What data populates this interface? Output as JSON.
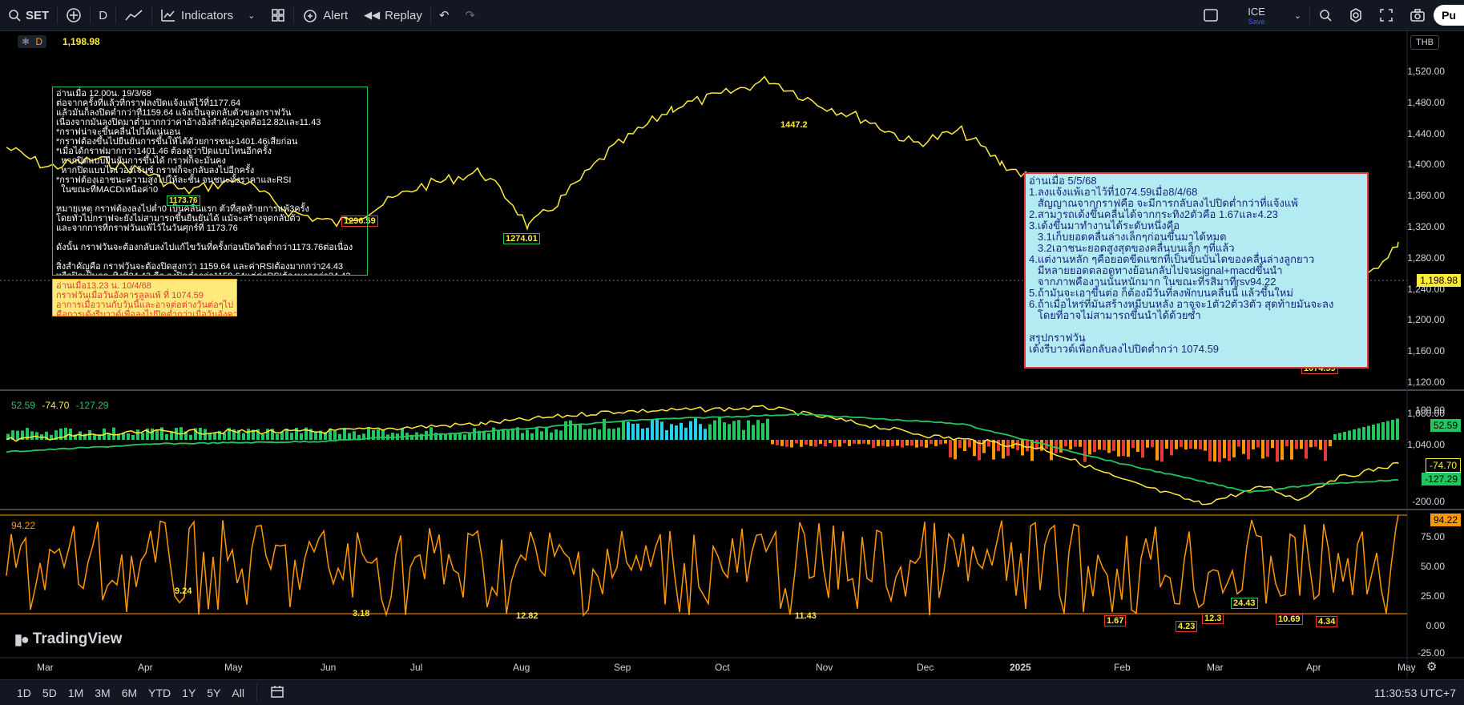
{
  "toolbar": {
    "symbol": "SET",
    "interval": "D",
    "indicators_label": "Indicators",
    "alert_label": "Alert",
    "replay_label": "Replay",
    "layout_name": "ICE",
    "layout_status": "Save",
    "publish_label": "Pu"
  },
  "chart": {
    "interval_badge": "D",
    "last_price": "1,198.98",
    "currency": "THB",
    "price_axis": [
      "1,520.00",
      "1,480.00",
      "1,440.00",
      "1,400.00",
      "1,360.00",
      "1,320.00",
      "1,280.00",
      "1,240.00",
      "1,200.00",
      "1,160.00",
      "1,120.00",
      "1,080.00",
      "1,040.00"
    ],
    "price_tag": "1,198.98",
    "time_axis": [
      "Mar",
      "Apr",
      "May",
      "Jun",
      "Jul",
      "Aug",
      "Sep",
      "Oct",
      "Nov",
      "Dec",
      "2025",
      "Feb",
      "Mar",
      "Apr",
      "May"
    ],
    "peak_labels": {
      "p1447": "1447.2",
      "p1274": "1274.01",
      "p1296": "1296.59",
      "p1173": "1173.76",
      "p1074": "1074.59"
    },
    "brand": "TradingView"
  },
  "macd": {
    "values": [
      "52.59",
      "-74.70",
      "-127.29"
    ],
    "axis": [
      "100.00",
      "-200.00"
    ],
    "tags": [
      "52.59",
      "-74.70",
      "-127.29"
    ]
  },
  "rsi": {
    "top_value": "94.22",
    "axis": [
      "75.00",
      "50.00",
      "25.00",
      "0.00",
      "-25.00"
    ],
    "tag": "94.22",
    "low_labels": [
      "9.24",
      "3.18",
      "12.82",
      "11.43",
      "1.67",
      "4.23",
      "12.3",
      "24.43",
      "10.69",
      "4.34"
    ]
  },
  "notes": {
    "note1": "อ่านเมื่อ 12.00น. 19/3/68\nต่อจากครั้งที่แล้วที่กราฟลงปิดแจ้งแพ้ไว้ที่1177.64\nแล้วมันก็ลงปิดต่ำกว่าที่1159.64 แจ้งเป็นจุดกลับตัวของกราฟวัน\nเนื่องจากมันลงปิดมาต่ำมากกว่าค่าอ้างอิงสำคัญ2จุดคือ12.82และ11.43\n*กราฟน่าจะขึ้นคลื่นไปได้แน่นอน\n*กราฟต้องขึ้นไปยืนยันการขึ้นให้ได้ด้วยการชนะ1401.46เสียก่อน\n*เมื่อได้กราฟมากกว่า1401.46 ต้องดูว่าปิดแบบไหนอีกครั้ง\n  หากปิดแบบยืนยันการขึ้นได้ กราฟก็จะมั่นคง\n  หากปิดแบบไดเวอร์เจ้นซ์ กราฟก็จะกลับลงไปอีกครั้ง\n*กราฟต้องเอาชนะความสูงไปให้ละชั้น จนชนะทั้งราคาและRSI\n  ในขณะที่MACDเหนือค่า0\n\nหมายเหตุ กราฟต้องลงไปต่ำ0 เป็นคลื่นแรก ตัวที่สุดท้ายการแพ้3ครั้ง\nโดยทั่วไปกราฟจะยังไม่สามารถขึ้นยืนยันได้ แม้จะสร้างจุดกลับตัว\nและจากการที่กราฟวันแพ้ไว้ในวันศุกร์ที่ 1173.76\n\nดังนั้น กราฟวันจะต้องกลับลงไปแก้ไขวันที่ครั้งก่อนปิดวิดต่ำกว่า1173.76ต่อเนื่อง\n\nสิ่งสำคัญคือ กราฟวันจะต้องปิดสูงกว่า 1159.64 และค่าRSIต้องมากกว่า24.43\nหรือปิดเป็นกระทิงที่24.43 คือ ลงปิดต่ำกว่า1159.64แต่ค่าRSIต้องมากกว่า24.43",
    "note2": "อ่านเมื่อ13.23 น. 10/4/68\nกราฟวันเมื่อวันอังคารลูลแพ้ ที่ 1074.59\nอาการเมื่อวานกับวันนี้และอาจต่อต่างวันต่อๆไป\nคือการเด้งรีบาวด์เพื่อลงไปปิดต่ำกว่าเมื่อวันอังคาร",
    "note3": "อ่านเมื่อ 5/5/68\n1.ลงแจ้งแพ้เอาไว้ที่1074.59เมื่อ8/4/68\n   สัญญาณจากกราฟคือ จะมีการกลับลงไปปิดต่ำกว่าที่แจ้งแพ้\n2.สามารถเด้งขึ้นคลื่นได้จากกระทิง2ตัวคือ 1.67และ4.23\n3.เด้งขึ้นมาทำงานได้ระดับหนึ่งคือ\n   3.1เก็บยอดคลื่นล่างเล็กๆก่อนขึ้นมาได้หมด\n   3.2เอาชนะยอดสูงสุดของคลื่นบนเล็ก ๆที่แล้ว\n4.แต่งานหลัก ๆคือยอดขีดแชกที่เป็นขั้นบันไดของคลื่นล่างลูกยาว\n   มีหลายยอดตลอดทางย้อนกลับไปจนsignal+macdขึ้นนำ\n   จากภาพคืองานนั้นหนักมาก ในขณะที่รสิมาที่rsv94.22\n5.ถ้ามันจะเอาขึ้นต่อ ก็ต้องมีวันที่ลงพักบนคลื่นนี้ แล้วขึ้นใหม่\n6.ถ้าเมื่อไหร่ที่มันสร้างหมีบนหลัง อาจจะ1ตัว2ตัว3ตัว สุดท้ายมันจะลง\n   โดยที่อาจไม่สามารถขึ้นนำได้ด้วยซ้ำ\n\nสรุปกราฟวัน\nเด้งรีบาวด์เพื่อกลับลงไปปิดต่ำกว่า 1074.59"
  },
  "bottom": {
    "ranges": [
      "1D",
      "5D",
      "1M",
      "3M",
      "6M",
      "YTD",
      "1Y",
      "5Y",
      "All"
    ],
    "clock": "11:30:53 UTC+7"
  },
  "colors": {
    "price_line": "#ffeb3b",
    "macd_signal": "#22c55e",
    "rsi_line": "#ff9800",
    "background": "#000000"
  }
}
